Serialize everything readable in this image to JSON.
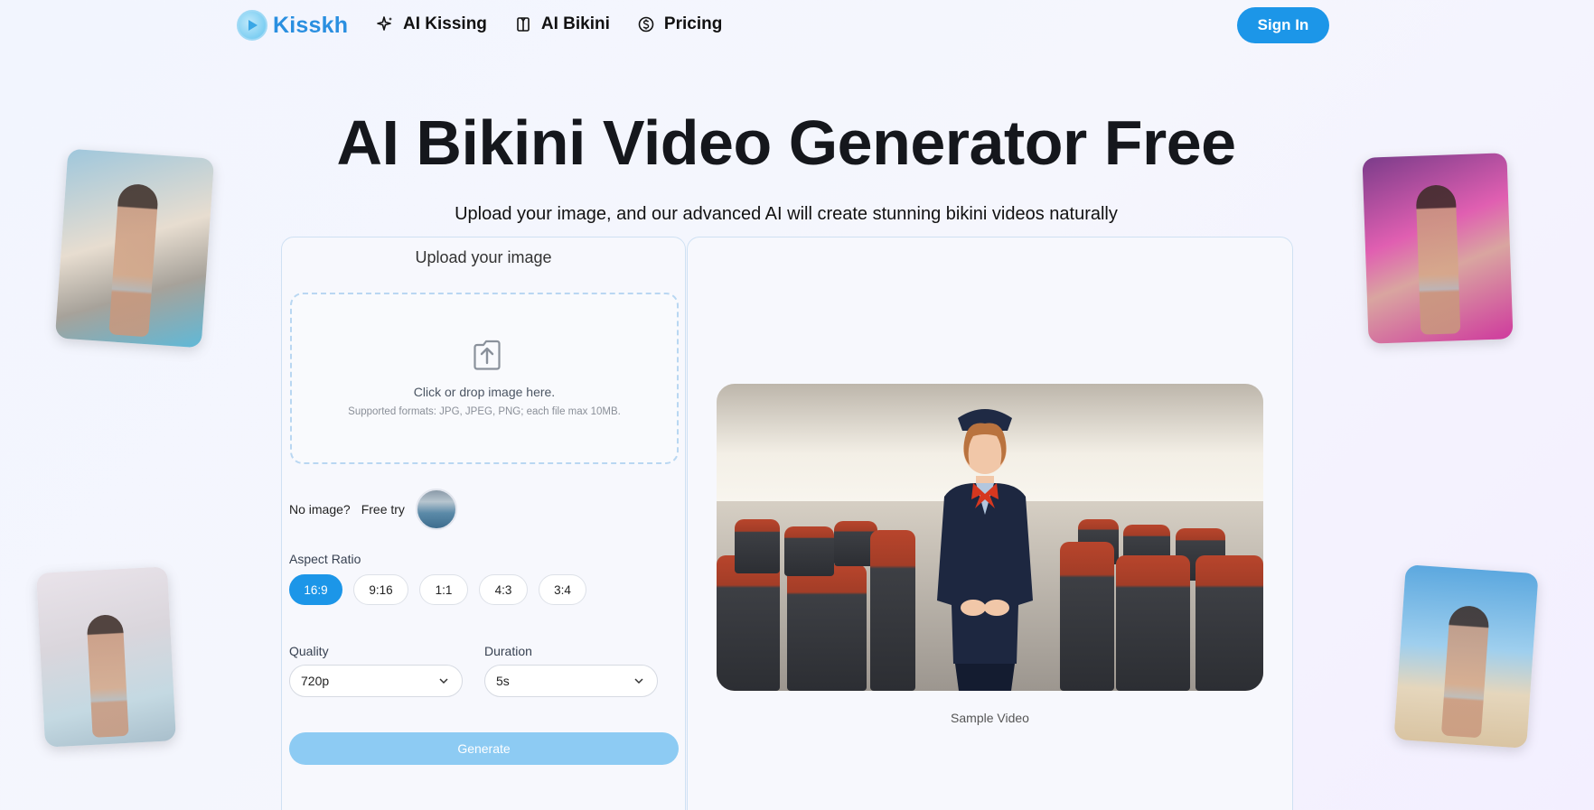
{
  "header": {
    "logo_text": "Kisskh",
    "nav": [
      {
        "label": "AI Kissing",
        "icon": "sparkle-icon"
      },
      {
        "label": "AI Bikini",
        "icon": "shirt-icon"
      },
      {
        "label": "Pricing",
        "icon": "dollar-circle-icon"
      }
    ],
    "signin_label": "Sign In"
  },
  "hero": {
    "title": "AI Bikini Video Generator Free",
    "subtitle": "Upload your image, and our advanced AI will create stunning bikini videos naturally"
  },
  "upload_panel": {
    "title": "Upload your image",
    "drop_text": "Click or drop image here.",
    "drop_hint": "Supported formats: JPG, JPEG, PNG; each file max 10MB.",
    "no_image_label": "No image?",
    "free_try_label": "Free try",
    "aspect_ratio_label": "Aspect Ratio",
    "aspect_ratios": [
      "16:9",
      "9:16",
      "1:1",
      "4:3",
      "3:4"
    ],
    "aspect_ratio_selected": "16:9",
    "quality_label": "Quality",
    "quality_value": "720p",
    "duration_label": "Duration",
    "duration_value": "5s",
    "generate_label": "Generate"
  },
  "preview_panel": {
    "caption": "Sample Video"
  },
  "colors": {
    "accent": "#1c96e8",
    "generate_disabled": "#8dcbf3",
    "logo": "#2a8fe0"
  }
}
